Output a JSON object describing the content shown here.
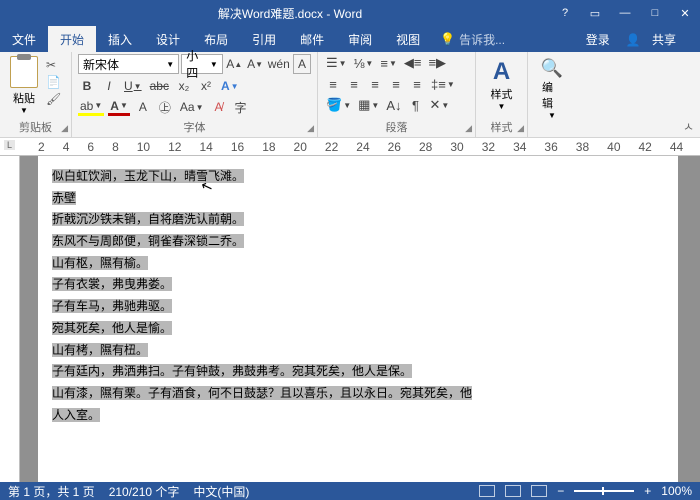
{
  "title": "解决Word难题.docx - Word",
  "menu": {
    "file": "文件",
    "home": "开始",
    "insert": "插入",
    "design": "设计",
    "layout": "布局",
    "references": "引用",
    "mailings": "邮件",
    "review": "审阅",
    "view": "视图",
    "tellme": "告诉我...",
    "signin": "登录",
    "share": "共享"
  },
  "ribbon": {
    "clipboard": {
      "paste": "粘贴",
      "label": "剪贴板"
    },
    "font": {
      "name": "新宋体",
      "size": "小四",
      "label": "字体",
      "wen": "wén",
      "A": "A"
    },
    "paragraph": {
      "label": "段落"
    },
    "styles": {
      "label": "样式",
      "btn": "样式"
    },
    "editing": {
      "label": "",
      "btn": "编辑"
    }
  },
  "ruler": [
    "2",
    "4",
    "6",
    "8",
    "10",
    "12",
    "14",
    "16",
    "18",
    "20",
    "22",
    "24",
    "26",
    "28",
    "30",
    "32",
    "34",
    "36",
    "38",
    "40",
    "42",
    "44"
  ],
  "doc": [
    "似白虹饮涧，玉龙下山，晴雪飞滩。",
    "赤壁",
    "折戟沉沙铁未销，自将磨洗认前朝。",
    "东风不与周郎便，铜雀春深锁二乔。",
    "山有枢，隰有榆。",
    "子有衣裳，弗曳弗娄。",
    "子有车马，弗驰弗驱。",
    "宛其死矣，他人是愉。",
    "山有栲，隰有杻。",
    "子有廷内，弗洒弗扫。子有钟鼓，弗鼓弗考。宛其死矣，他人是保。",
    "山有漆，隰有栗。子有酒食，何不日鼓瑟？且以喜乐，且以永日。宛其死矣，他",
    "人入室。"
  ],
  "status": {
    "page": "第 1 页，共 1 页",
    "words": "210/210 个字",
    "lang": "中文(中国)",
    "zoom": "100%"
  }
}
